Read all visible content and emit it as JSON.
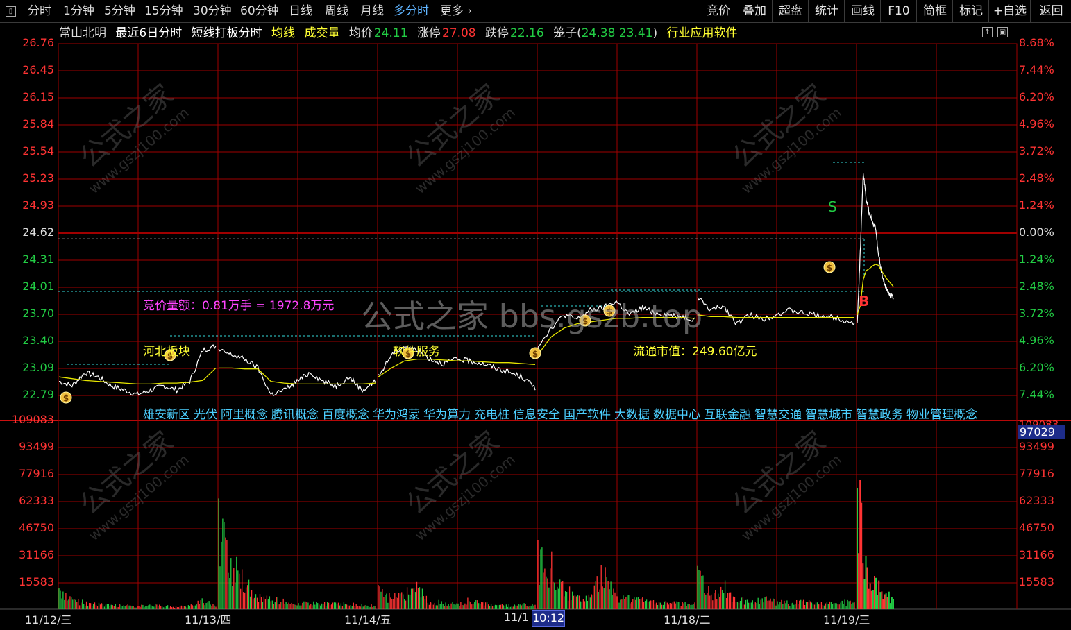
{
  "toolbar": {
    "tabs": [
      "分时",
      "1分钟",
      "5分钟",
      "15分钟",
      "30分钟",
      "60分钟",
      "日线",
      "周线",
      "月线",
      "多分时",
      "更多"
    ],
    "active": "多分时",
    "right_buttons": [
      "竞价",
      "叠加",
      "超盘",
      "统计",
      "画线",
      "F10",
      "简框",
      "标记",
      "+自选",
      "返回"
    ]
  },
  "info": {
    "stock_name": "常山北明",
    "mode": "最近6日分时",
    "formula": "短线打板分时",
    "ma_label": "均线",
    "vol_label": "成交量",
    "avg_label": "均价",
    "avg_value": "24.11",
    "limit_up_label": "涨停",
    "limit_up_value": "27.08",
    "limit_down_label": "跌停",
    "limit_down_value": "22.16",
    "cage_label": "笼子(",
    "cage_values": "24.38  23.41",
    "cage_close": ")",
    "industry": "行业应用软件"
  },
  "colors": {
    "grid": "#a00000",
    "up": "#ff3333",
    "down": "#22cc44",
    "price_line": "#ffffff",
    "avg_line": "#e6e600",
    "dashed": "#33dddd",
    "prev_close": "#ffffff",
    "magenta": "#ff44ff",
    "yellow": "#ffff33",
    "cyan": "#4cd0ff"
  },
  "price_axis": {
    "left": [
      "26.76",
      "26.45",
      "26.15",
      "25.84",
      "25.54",
      "25.23",
      "24.93",
      "24.62",
      "24.31",
      "24.01",
      "23.70",
      "23.40",
      "23.09",
      "22.79"
    ],
    "right": [
      "8.68%",
      "7.44%",
      "6.20%",
      "4.96%",
      "3.72%",
      "2.48%",
      "1.24%",
      "0.00%",
      "1.24%",
      "2.48%",
      "3.72%",
      "4.96%",
      "6.20%",
      "7.44%"
    ],
    "prev_close": 24.62
  },
  "volume_axis": {
    "left": [
      "109083",
      "93499",
      "77916",
      "62333",
      "46750",
      "31166",
      "15583"
    ],
    "right": [
      "109083",
      "93499",
      "77916",
      "62333",
      "46750",
      "31166",
      "15583"
    ],
    "current_value": "97029"
  },
  "dates": [
    "11/12/三",
    "11/13/四",
    "11/14/五",
    "11/1",
    "11/18/二",
    "11/19/三"
  ],
  "cursor_time": "10:12",
  "annotations": {
    "auction": "竞价量额：0.81万手 = 1972.8万元",
    "sector1": "河北板块",
    "sector2": "软件服务",
    "market_cap": "流通市值：249.60亿元",
    "sell_mark": "S",
    "buy_mark": "B",
    "coin_mark": "$"
  },
  "concepts": [
    "雄安新区",
    "光伏",
    "阿里概念",
    "腾讯概念",
    "百度概念",
    "华为鸿蒙",
    "华为算力",
    "充电桩",
    "信息安全",
    "国产软件",
    "大数据",
    "数据中心",
    "互联金融",
    "智慧交通",
    "智慧城市",
    "智慧政务",
    "物业管理概念"
  ],
  "watermark": {
    "big": "公式之家 bbs.gszb.top",
    "small": "公式之家",
    "url": "www.gszj100.com"
  },
  "chart_data": {
    "type": "line",
    "days": [
      "11/12",
      "11/13",
      "11/14",
      "11/17",
      "11/18",
      "11/19"
    ],
    "price_series": [
      [
        22.95,
        22.9,
        23.05,
        23.0,
        22.9,
        22.85,
        22.8,
        22.85,
        22.9,
        22.85,
        22.95,
        23.3,
        23.35
      ],
      [
        23.3,
        23.25,
        23.2,
        23.1,
        22.8,
        22.85,
        22.95,
        23.05,
        22.95,
        22.9,
        23.0,
        22.85,
        22.95
      ],
      [
        23.0,
        23.25,
        23.35,
        23.3,
        23.2,
        23.15,
        23.2,
        23.18,
        23.15,
        23.1,
        23.05,
        23.0,
        22.88
      ],
      [
        23.35,
        23.55,
        23.7,
        23.65,
        23.75,
        23.78,
        23.85,
        23.7,
        23.78,
        23.72,
        23.7,
        23.68,
        23.65
      ],
      [
        23.9,
        23.75,
        23.8,
        23.6,
        23.7,
        23.65,
        23.7,
        23.75,
        23.72,
        23.7,
        23.68,
        23.65,
        23.6
      ],
      [
        23.6,
        24.4,
        25.3,
        25.0,
        24.85,
        24.75,
        24.7,
        24.4,
        24.2,
        24.05,
        23.98,
        23.92,
        23.9
      ]
    ],
    "avg_series": [
      [
        23.0,
        22.98,
        22.96,
        22.95,
        22.94,
        22.93,
        22.92,
        22.92,
        22.93,
        22.93,
        22.94,
        22.96,
        23.1
      ],
      [
        23.1,
        23.1,
        23.09,
        23.09,
        22.95,
        22.93,
        22.92,
        22.92,
        22.92,
        22.92,
        22.92,
        22.92,
        22.93
      ],
      [
        23.0,
        23.1,
        23.18,
        23.2,
        23.2,
        23.19,
        23.18,
        23.18,
        23.17,
        23.16,
        23.16,
        23.15,
        23.14
      ],
      [
        23.25,
        23.45,
        23.55,
        23.6,
        23.62,
        23.64,
        23.66,
        23.66,
        23.67,
        23.67,
        23.67,
        23.67,
        23.66
      ],
      [
        23.7,
        23.68,
        23.68,
        23.67,
        23.67,
        23.67,
        23.67,
        23.67,
        23.67,
        23.67,
        23.67,
        23.67,
        23.67
      ],
      [
        23.7,
        23.8,
        24.1,
        24.2,
        24.22,
        24.25,
        24.27,
        24.26,
        24.2,
        24.15,
        24.1,
        24.06,
        24.02
      ]
    ],
    "volume_bars": [
      [
        12000,
        8000,
        5000,
        4000,
        3000,
        3500,
        2500,
        3000,
        2500,
        2000,
        2500,
        7000,
        3000
      ],
      [
        64000,
        37000,
        22000,
        10000,
        8000,
        6000,
        5000,
        4500,
        5000,
        4000,
        4000,
        3500,
        3000
      ],
      [
        14000,
        9000,
        12000,
        16000,
        6000,
        5000,
        4000,
        8000,
        5000,
        3500,
        3000,
        4000,
        3000
      ],
      [
        40000,
        35000,
        15000,
        12000,
        9000,
        32000,
        10000,
        8000,
        7000,
        6000,
        5000,
        4500,
        4000
      ],
      [
        25000,
        12000,
        18000,
        8000,
        7000,
        8000,
        6000,
        5000,
        5500,
        5000,
        4500,
        6000,
        5000
      ],
      [
        70000,
        85000,
        45000,
        36000,
        25000,
        30000,
        22000,
        18000,
        14000,
        16000,
        12000,
        10000,
        8000
      ]
    ],
    "ylim": [
      22.48,
      26.76
    ],
    "vol_ylim": [
      0,
      109083
    ]
  }
}
